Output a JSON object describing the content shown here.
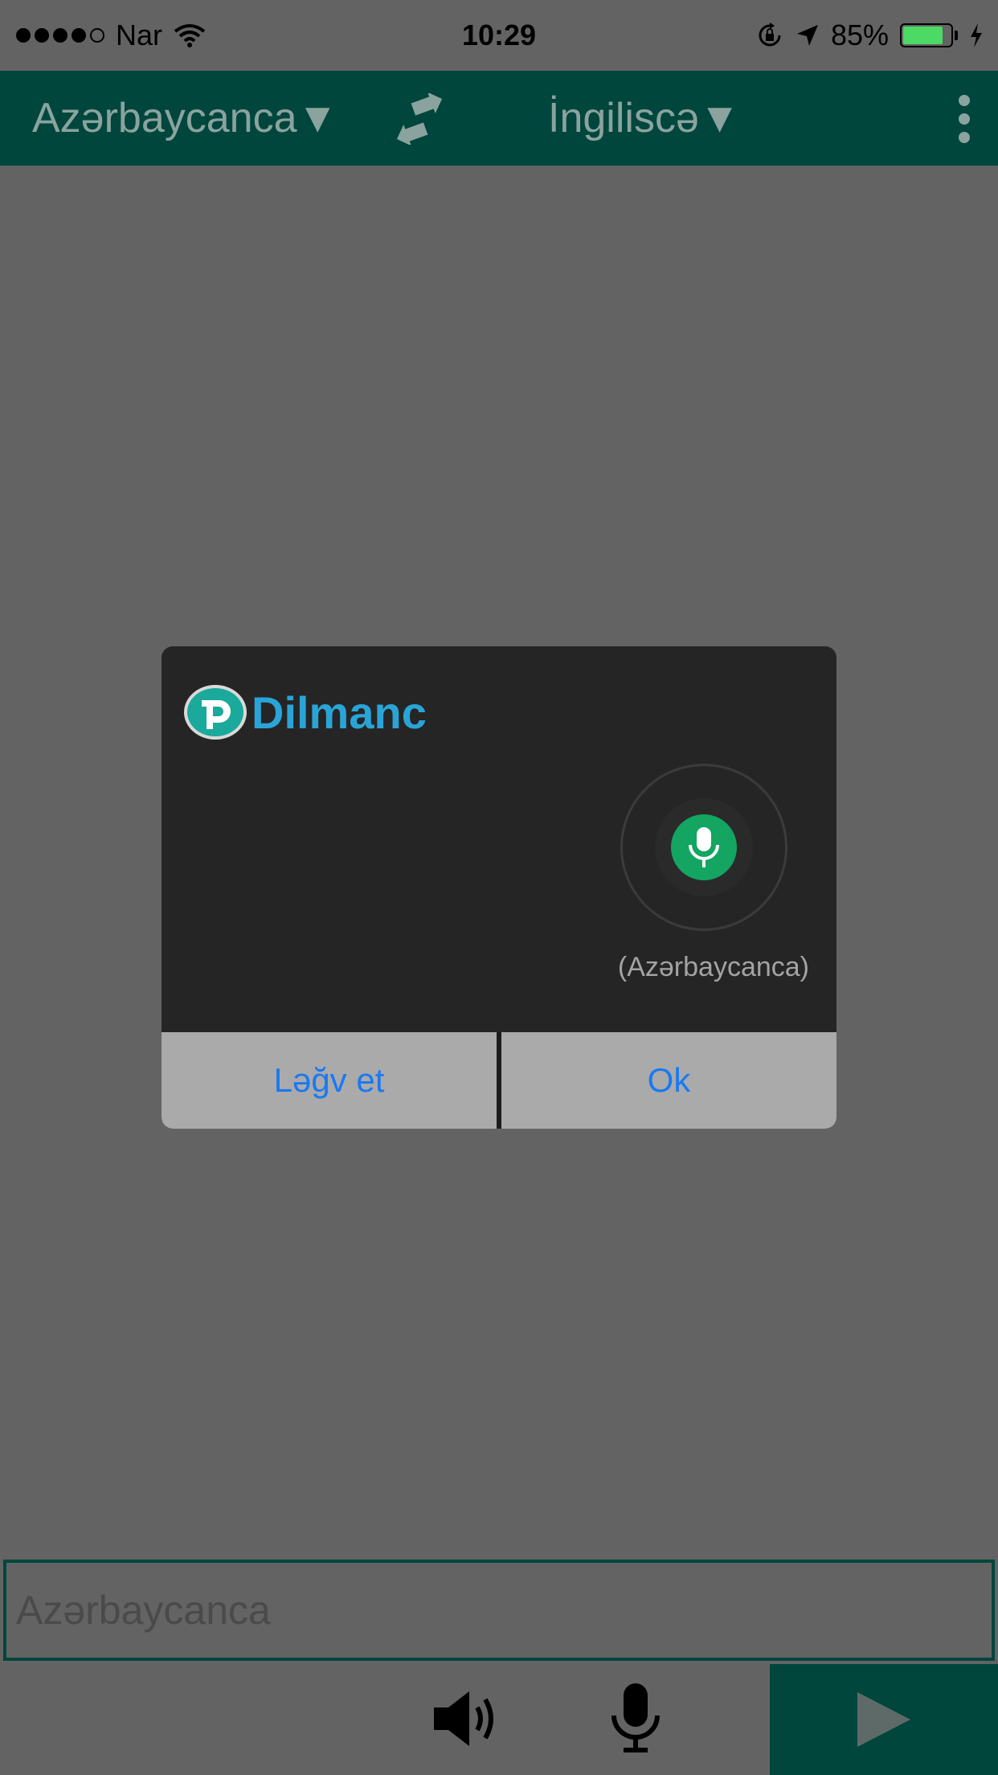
{
  "status_bar": {
    "carrier": "Nar",
    "time": "10:29",
    "battery_percent": "85%",
    "battery_level": 0.85,
    "icons": [
      "signal-dots-icon",
      "wifi-icon",
      "rotation-lock-icon",
      "location-arrow-icon",
      "battery-icon",
      "charging-bolt-icon"
    ]
  },
  "toolbar": {
    "source_language": "Azərbaycanca▼",
    "target_language": "İngiliscə▼",
    "icons": [
      "swap-arrows-icon",
      "more-vertical-icon"
    ]
  },
  "dialog": {
    "logo_text": "Dilmanc",
    "language_label": "(Azərbaycanca)",
    "cancel_label": "Ləğv et",
    "ok_label": "Ok",
    "icons": [
      "dilmanc-logo-icon",
      "microphone-icon"
    ]
  },
  "input": {
    "placeholder": "Azərbaycanca",
    "value": ""
  },
  "bottom_bar": {
    "icons": [
      "speaker-icon",
      "microphone-icon",
      "send-play-icon"
    ]
  },
  "colors": {
    "background_dim": "#636363",
    "toolbar": "#00463d",
    "dialog_background": "#252525",
    "dialog_button": "#aaaaaa",
    "button_text": "#1a79f3",
    "mic_green": "#13a561",
    "logo_blue": "#2aa4d6"
  }
}
